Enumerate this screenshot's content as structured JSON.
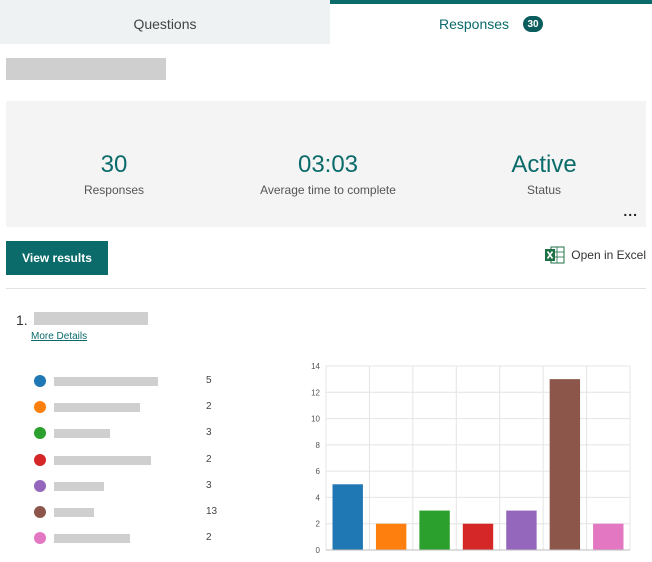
{
  "tabs": {
    "questions": "Questions",
    "responses": "Responses",
    "responses_count": "30"
  },
  "summary": {
    "responses_value": "30",
    "responses_label": "Responses",
    "avg_time_value": "03:03",
    "avg_time_label": "Average time to complete",
    "status_value": "Active",
    "status_label": "Status",
    "more_label": "..."
  },
  "actions": {
    "view_results": "View results",
    "open_in_excel": "Open in Excel"
  },
  "question": {
    "number": "1.",
    "more_details": "More Details",
    "options": [
      {
        "color": "#1f77b4",
        "count": "5"
      },
      {
        "color": "#ff7f0e",
        "count": "2"
      },
      {
        "color": "#2ca02c",
        "count": "3"
      },
      {
        "color": "#d62728",
        "count": "2"
      },
      {
        "color": "#9467bd",
        "count": "3"
      },
      {
        "color": "#8c564b",
        "count": "13"
      },
      {
        "color": "#e377c2",
        "count": "2"
      }
    ]
  },
  "chart_data": {
    "type": "bar",
    "values": [
      5,
      2,
      3,
      2,
      3,
      13,
      2
    ],
    "colors": [
      "#1f77b4",
      "#ff7f0e",
      "#2ca02c",
      "#d62728",
      "#9467bd",
      "#8c564b",
      "#e377c2"
    ],
    "ylim": [
      0,
      14
    ],
    "yticks": [
      "0",
      "2",
      "4",
      "6",
      "8",
      "10",
      "12",
      "14"
    ],
    "grid": true
  },
  "colors": {
    "accent": "#0b6a6a"
  }
}
